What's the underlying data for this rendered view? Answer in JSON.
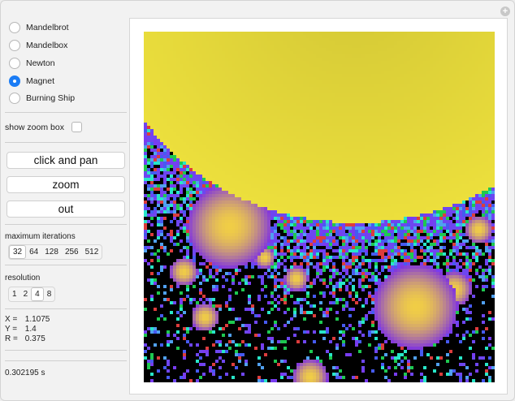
{
  "fractal_types": [
    {
      "label": "Mandelbrot",
      "selected": false
    },
    {
      "label": "Mandelbox",
      "selected": false
    },
    {
      "label": "Newton",
      "selected": false
    },
    {
      "label": "Magnet",
      "selected": true
    },
    {
      "label": "Burning Ship",
      "selected": false
    }
  ],
  "zoom_box": {
    "label": "show zoom box",
    "checked": false
  },
  "buttons": {
    "pan": "click and pan",
    "zoom": "zoom",
    "out": "out"
  },
  "max_iterations": {
    "label": "maximum iterations",
    "options": [
      "32",
      "64",
      "128",
      "256",
      "512"
    ],
    "selected": "32"
  },
  "resolution": {
    "label": "resolution",
    "options": [
      "1",
      "2",
      "4",
      "8"
    ],
    "selected": "4"
  },
  "coords": {
    "x_label": "X =",
    "x_value": "1.1075",
    "y_label": "Y =",
    "y_value": "1.4",
    "r_label": "R =",
    "r_value": "0.375"
  },
  "timing": "0.302195 s",
  "colors": {
    "accent": "#1a7cf5",
    "yellow": "#ecdf3c",
    "purple": "#7a3cf0",
    "background": "#000000"
  },
  "icons": {
    "corner": "plus-icon"
  }
}
